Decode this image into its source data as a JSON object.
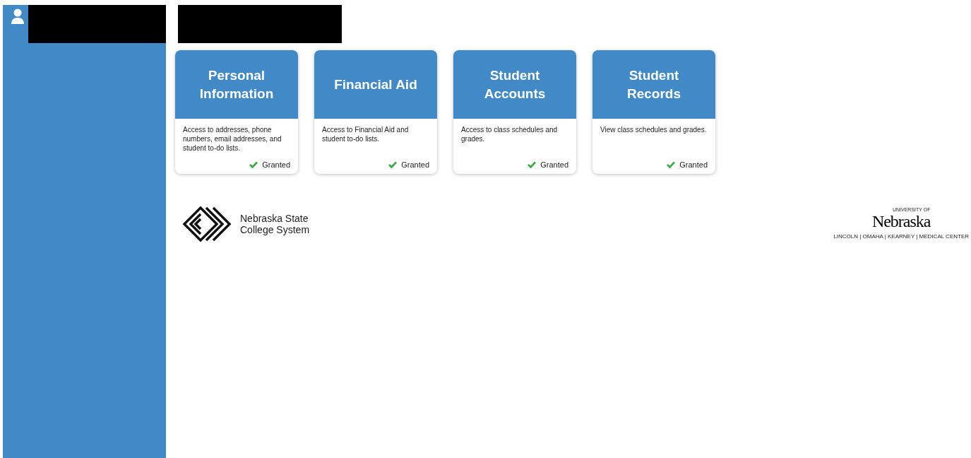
{
  "cards": [
    {
      "title": "Personal Information",
      "description": "Access to addresses, phone numbers, email addresses, and student to-do lists.",
      "status": "Granted"
    },
    {
      "title": "Financial Aid",
      "description": "Access to Financial Aid and student to-do lists.",
      "status": "Granted"
    },
    {
      "title": "Student Accounts",
      "description": "Access to class schedules and grades.",
      "status": "Granted"
    },
    {
      "title": "Student Records",
      "description": "View class schedules and grades.",
      "status": "Granted"
    }
  ],
  "footer": {
    "left_logo": [
      "Nebraska State",
      "College System"
    ],
    "right_logo": {
      "superscript": "UNIVERSITY OF",
      "name": "Nebraska",
      "campuses": "LINCOLN | OMAHA | KEARNEY | MEDICAL CENTER"
    }
  }
}
